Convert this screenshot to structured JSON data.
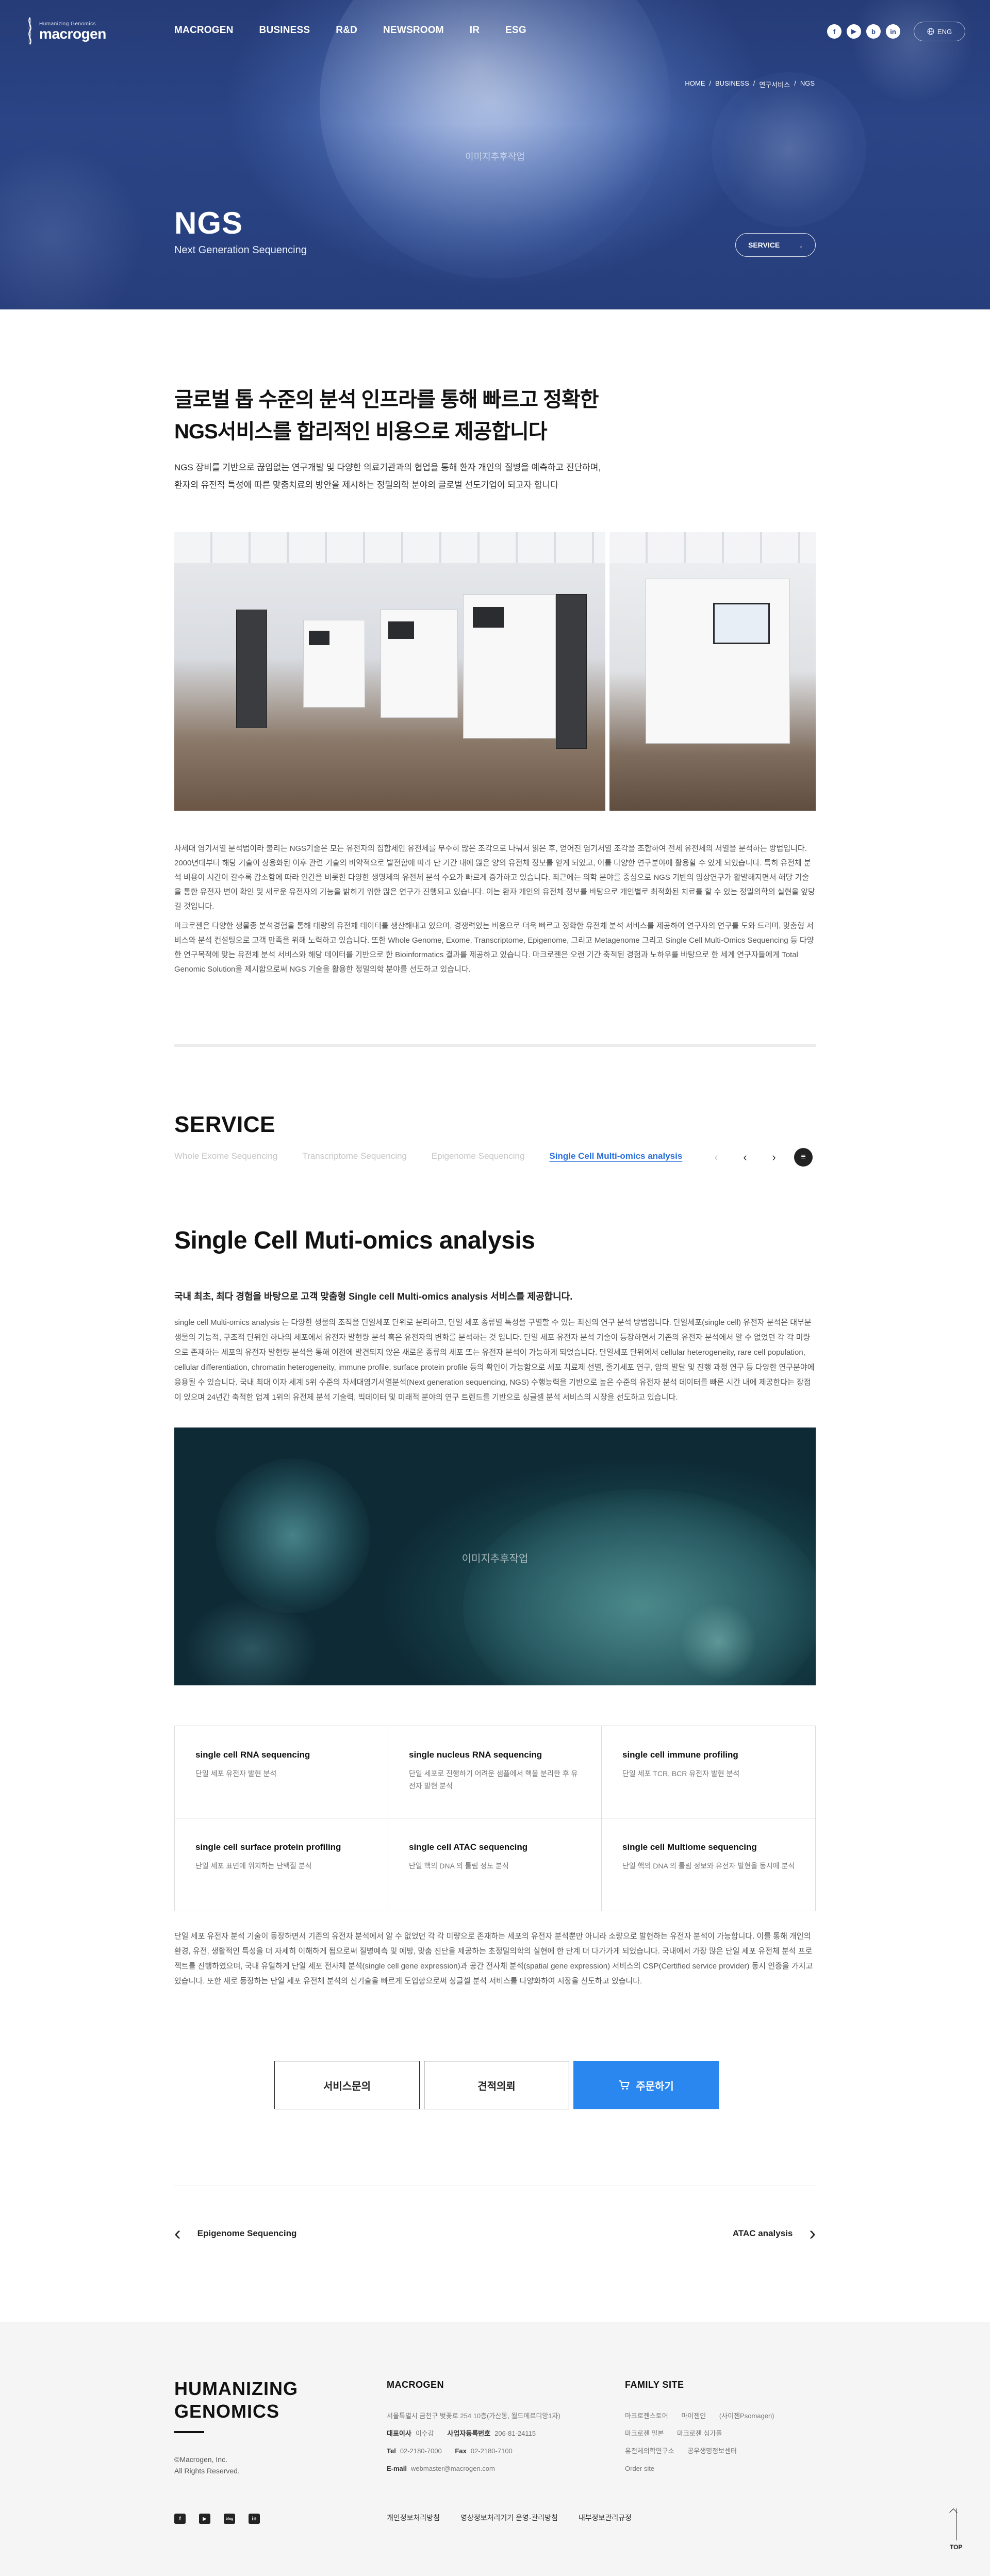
{
  "header": {
    "logo_small": "Humanizing Genomics",
    "logo_text": "macrogen",
    "nav": [
      "MACROGEN",
      "BUSINESS",
      "R&D",
      "NEWSROOM",
      "IR",
      "ESG"
    ],
    "social": [
      {
        "icon": "facebook-icon",
        "glyph": "f"
      },
      {
        "icon": "youtube-icon",
        "glyph": "▶"
      },
      {
        "icon": "blog-icon",
        "glyph": "b"
      },
      {
        "icon": "linkedin-icon",
        "glyph": "in"
      }
    ],
    "lang_label": "ENG"
  },
  "hero": {
    "breadcrumb": [
      "HOME",
      "BUSINESS",
      "연구서비스",
      "NGS"
    ],
    "watermark": "이미지추후작업",
    "title": "NGS",
    "subtitle": "Next Generation Sequencing",
    "service_button": "SERVICE"
  },
  "intro": {
    "headline_1": "글로벌 톱 수준의 분석 인프라를 통해 빠르고 정확한",
    "headline_2": "NGS서비스를 합리적인 비용으로 제공합니다",
    "lead_1": "NGS 장비를 기반으로 끊임없는 연구개발 및 다양한 의료기관과의 협업을 통해 환자 개인의 질병을 예측하고 진단하며,",
    "lead_2": "환자의 유전적 특성에 따른 맞춤치료의 방안을 제시하는 정밀의학 분야의 글로벌 선도기업이 되고자 합니다",
    "para_1": "차세대 염기서열 분석법이라 불리는 NGS기술은 모든 유전자의 집합체인 유전체를 무수히 많은 조각으로 나눠서 읽은 후, 얻어진 염기서열 조각을 조합하여 전체 유전체의 서열을 분석하는 방법입니다. 2000년대부터 해당 기술이 상용화된 이후 관련 기술의 비약적으로 발전함에 따라 단 기간 내에 많은 양의 유전체 정보를 얻게 되었고, 이를 다양한 연구분야에 활용할 수 있게 되었습니다. 특히 유전체 분석 비용이 시간이 갈수록 감소함에 따라 인간을 비롯한 다양한 생명체의 유전체 분석 수요가 빠르게 증가하고 있습니다. 최근에는 의학 분야를 중심으로 NGS 기반의 임상연구가 활발해지면서 해당 기술을 통한 유전자 변이 확인 및 새로운 유전자의 기능을 밝히기 위한 많은 연구가 진행되고 있습니다. 이는 환자 개인의 유전체 정보를 바탕으로 개인별로 최적화된 치료를 할 수 있는 정밀의학의 실현을 앞당길 것입니다.",
    "para_2": "마크로젠은 다양한 생물종 분석경험을 통해 대량의 유전체 데이터를 생산해내고 있으며, 경쟁력있는 비용으로 더욱 빠르고 정확한 유전체 분석 서비스를 제공하여 연구자의 연구를 도와 드리며, 맞춤형 서비스와 분석 컨설팅으로 고객 만족을 위해 노력하고 있습니다. 또한 Whole Genome, Exome, Transcriptome, Epigenome, 그리고 Metagenome 그리고 Single Cell Multi-Omics Sequencing 등 다양한 연구목적에 맞는 유전체 분석 서비스와 해당 데이터를 기반으로 한 Bioinformatics 결과를 제공하고 있습니다. 마크로젠은 오랜 기간 축적된 경험과 노하우를 바탕으로 한 세계 연구자들에게 Total Genomic Solution을 제시함으로써 NGS 기술을 활용한 정밀의학 분야를 선도하고 있습니다."
  },
  "service": {
    "title": "SERVICE",
    "tabs": [
      {
        "label": "Whole Exome Sequencing",
        "active": false
      },
      {
        "label": "Transcriptome Sequencing",
        "active": false
      },
      {
        "label": "Epigenome Sequencing",
        "active": false
      },
      {
        "label": "Single Cell Multi-omics analysis",
        "active": true
      }
    ],
    "prev_arrow": "‹",
    "next_arrow": "›",
    "menu_icon": "≡"
  },
  "single_cell": {
    "title": "Single Cell Muti-omics analysis",
    "lead": "국내 최초, 최다 경험을 바탕으로 고객 맞춤형 Single cell Multi-omics analysis 서비스를 제공합니다.",
    "desc": "single cell Multi-omics analysis 는 다양한 생물의 조직을 단일세포 단위로 분리하고, 단일 세포 종류별 특성을 구별할 수 있는 최신의 연구 분석 방법입니다. 단일세포(single cell) 유전자 분석은 대부분 생물의 기능적, 구조적 단위인 하나의 세포에서 유전자 발현량 분석 혹은 유전자의 변화를 분석하는 것 입니다. 단일 세포 유전자 분석 기술이 등장하면서 기존의 유전자 분석에서 알 수 없었던 각 각 미량으로 존재하는 세포의 유전자 발현량 분석을 통해 이전에 발견되지 않은 새로운 종류의 세포 또는 유전자 분석이 가능하게 되었습니다. 단일세포 단위에서 cellular heterogeneity, rare cell population, cellular differentiation, chromatin heterogeneity, immune profile, surface protein profile 등의 확인이 가능함으로 세포 치료제 선별, 줄기세포 연구, 암의 발달 및 진행 과정 연구 등 다양한 연구분야에 응용될 수 있습니다. 국내 최대 이자 세계 5위 수준의 차세대염기서열분석(Next generation sequencing, NGS) 수행능력을 기반으로 높은 수준의 유전자 분석 데이터를 빠른 시간 내에 제공한다는 장점이 있으며 24년간 축적한 업계 1위의 유전체 분석 기술력, 빅데이터 및 미래적 분야의 연구 트렌드를 기반으로 싱글셀 분석 서비스의 시장을 선도하고 있습니다.",
    "image_watermark": "이미지추후작업",
    "items": [
      {
        "title": "single cell RNA sequencing",
        "desc": "단일 세포 유전자 발현 분석"
      },
      {
        "title": "single nucleus RNA sequencing",
        "desc": "단일 세포로 진행하기 어려운 샘플에서 핵을 분리한 후 유전자 발현 분석"
      },
      {
        "title": "single cell immune profiling",
        "desc": "단일 세포 TCR, BCR 유전자 발현 분석"
      },
      {
        "title": "single cell surface protein profiling",
        "desc": "단일 세포 표면에 위치하는 단백질 분석"
      },
      {
        "title": "single cell ATAC sequencing",
        "desc": "단일 핵의 DNA 의 툴림 정도 분석"
      },
      {
        "title": "single cell Multiome sequencing",
        "desc": "단일 핵의 DNA 의 툴림 정보와 유전자 발현을 동시에 분석"
      }
    ],
    "foot": "단일 세포 유전자 분석 기술이 등장하면서 기존의 유전자 분석에서 알 수 없었던 각 각 미량으로 존재하는 세포의 유전자 분석뿐만 아니라 소량으로 발현하는 유전자 분석이 가능합니다. 이를 통해 개인의 환경, 유전, 생활적인 특성을 더 자세히 이해하게 됨으로써 질병예측 및 예방, 맞춤 진단을 제공하는 초정밀의학의 실현에 한 단계 더 다가가게 되었습니다. 국내에서 가장 많은 단일 세포 유전체 분석 프로젝트를 진행하였으며, 국내 유일하게 단일 세포 전사체 분석(single cell gene expression)과 공간 전사체 분석(spatial gene expression) 서비스의 CSP(Certified service provider) 동시 인증을 가지고 있습니다. 또한 새로 등장하는 단일 세포 유전체 분석의 신기술을 빠르게 도입함으로써 싱글셀 분석 서비스를 다양화하여 시장을 선도하고 있습니다."
  },
  "actions": {
    "inquiry": "서비스문의",
    "quote": "견적의뢰",
    "order": "주문하기"
  },
  "pager": {
    "prev_label": "Epigenome Sequencing",
    "next_label": "ATAC analysis"
  },
  "footer": {
    "brand_1": "HUMANIZING",
    "brand_2": "GENOMICS",
    "copy_1": "©Macrogen, Inc.",
    "copy_2": "All Rights Reserved.",
    "sns": [
      {
        "icon": "facebook-icon",
        "glyph": "f"
      },
      {
        "icon": "youtube-icon",
        "glyph": "▶"
      },
      {
        "icon": "blog-icon",
        "glyph": "blog"
      },
      {
        "icon": "linkedin-icon",
        "glyph": "in"
      }
    ],
    "col_title": "MACROGEN",
    "address": "서울특별시 금천구 벚꽃로 254 10층(가산동, 월드메르디앙1차)",
    "ceo_label": "대표이사",
    "ceo_value": "이수강",
    "biz_label": "사업자등록번호",
    "biz_value": "206-81-24115",
    "tel_label": "Tel",
    "tel_value": "02-2180-7000",
    "fax_label": "Fax",
    "fax_value": "02-2180-7100",
    "email_label": "E-mail",
    "email_value": "webmaster@macrogen.com",
    "family_title": "FAMILY SITE",
    "family_row1": [
      "마크로젠스토어",
      "마이젠인",
      "(사이젠Psomagen)"
    ],
    "family_row2": [
      "마크로젠 일본",
      "마크로젠 싱가폴"
    ],
    "family_row3": [
      "유전체의학연구소",
      "공우생명정보센터"
    ],
    "family_row4": [
      "Order site"
    ],
    "links": [
      "개인정보처리방침",
      "영상정보처리기기 운영·관리방침",
      "내부정보관리규정"
    ],
    "top_label": "TOP"
  }
}
